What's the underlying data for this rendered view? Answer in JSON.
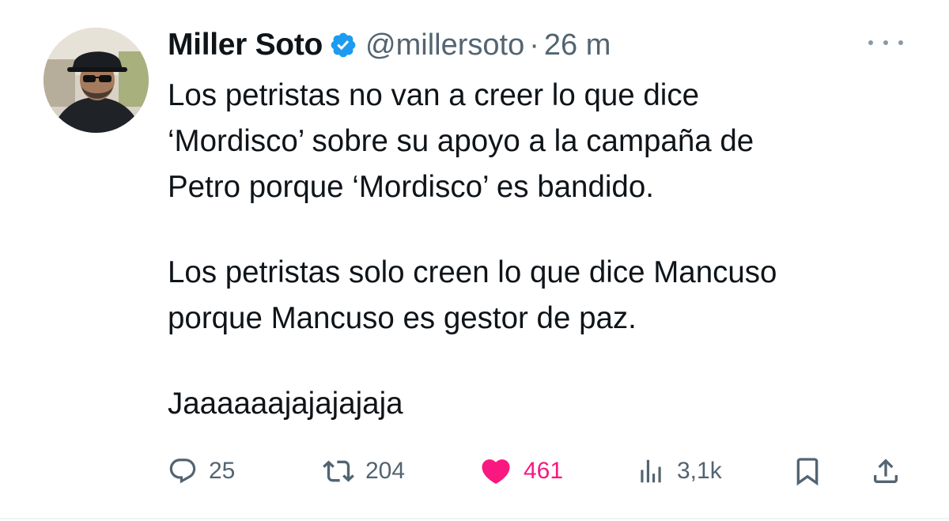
{
  "tweet": {
    "author": {
      "display_name": "Miller Soto",
      "handle": "@millersoto",
      "verified": true,
      "avatar_icon": "avatar-photo"
    },
    "separator": "·",
    "time": "26 m",
    "more_icon": "more-dots-icon",
    "text": {
      "paragraph_1": "Los petristas no van a creer lo que dice\n‘Mordisco’ sobre su apoyo a la campaña de\nPetro porque ‘Mordisco’ es bandido.",
      "paragraph_2": "Los petristas solo creen lo que dice Mancuso\nporque Mancuso es gestor de paz.",
      "paragraph_3": "Jaaaaaajajajajaja"
    },
    "actions": {
      "replies": "25",
      "retweets": "204",
      "likes": "461",
      "views": "3,1k"
    },
    "colors": {
      "verified_badge": "#1d9bf0",
      "like_active": "#f91880",
      "secondary_text": "#536471",
      "primary_text": "#0f1419"
    }
  }
}
